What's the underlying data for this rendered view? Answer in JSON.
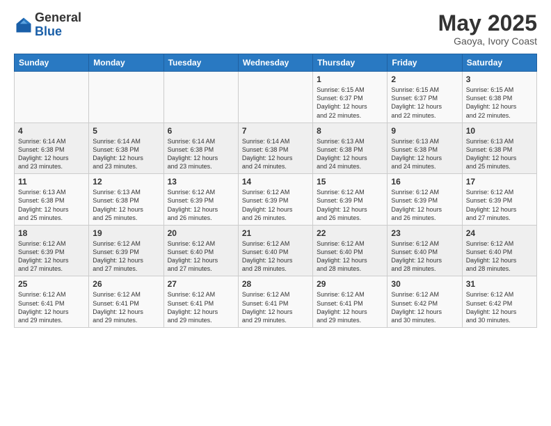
{
  "header": {
    "logo_general": "General",
    "logo_blue": "Blue",
    "month_year": "May 2025",
    "location": "Gaoya, Ivory Coast"
  },
  "weekdays": [
    "Sunday",
    "Monday",
    "Tuesday",
    "Wednesday",
    "Thursday",
    "Friday",
    "Saturday"
  ],
  "weeks": [
    [
      {
        "day": "",
        "info": ""
      },
      {
        "day": "",
        "info": ""
      },
      {
        "day": "",
        "info": ""
      },
      {
        "day": "",
        "info": ""
      },
      {
        "day": "1",
        "info": "Sunrise: 6:15 AM\nSunset: 6:37 PM\nDaylight: 12 hours\nand 22 minutes."
      },
      {
        "day": "2",
        "info": "Sunrise: 6:15 AM\nSunset: 6:37 PM\nDaylight: 12 hours\nand 22 minutes."
      },
      {
        "day": "3",
        "info": "Sunrise: 6:15 AM\nSunset: 6:38 PM\nDaylight: 12 hours\nand 22 minutes."
      }
    ],
    [
      {
        "day": "4",
        "info": "Sunrise: 6:14 AM\nSunset: 6:38 PM\nDaylight: 12 hours\nand 23 minutes."
      },
      {
        "day": "5",
        "info": "Sunrise: 6:14 AM\nSunset: 6:38 PM\nDaylight: 12 hours\nand 23 minutes."
      },
      {
        "day": "6",
        "info": "Sunrise: 6:14 AM\nSunset: 6:38 PM\nDaylight: 12 hours\nand 23 minutes."
      },
      {
        "day": "7",
        "info": "Sunrise: 6:14 AM\nSunset: 6:38 PM\nDaylight: 12 hours\nand 24 minutes."
      },
      {
        "day": "8",
        "info": "Sunrise: 6:13 AM\nSunset: 6:38 PM\nDaylight: 12 hours\nand 24 minutes."
      },
      {
        "day": "9",
        "info": "Sunrise: 6:13 AM\nSunset: 6:38 PM\nDaylight: 12 hours\nand 24 minutes."
      },
      {
        "day": "10",
        "info": "Sunrise: 6:13 AM\nSunset: 6:38 PM\nDaylight: 12 hours\nand 25 minutes."
      }
    ],
    [
      {
        "day": "11",
        "info": "Sunrise: 6:13 AM\nSunset: 6:38 PM\nDaylight: 12 hours\nand 25 minutes."
      },
      {
        "day": "12",
        "info": "Sunrise: 6:13 AM\nSunset: 6:38 PM\nDaylight: 12 hours\nand 25 minutes."
      },
      {
        "day": "13",
        "info": "Sunrise: 6:12 AM\nSunset: 6:39 PM\nDaylight: 12 hours\nand 26 minutes."
      },
      {
        "day": "14",
        "info": "Sunrise: 6:12 AM\nSunset: 6:39 PM\nDaylight: 12 hours\nand 26 minutes."
      },
      {
        "day": "15",
        "info": "Sunrise: 6:12 AM\nSunset: 6:39 PM\nDaylight: 12 hours\nand 26 minutes."
      },
      {
        "day": "16",
        "info": "Sunrise: 6:12 AM\nSunset: 6:39 PM\nDaylight: 12 hours\nand 26 minutes."
      },
      {
        "day": "17",
        "info": "Sunrise: 6:12 AM\nSunset: 6:39 PM\nDaylight: 12 hours\nand 27 minutes."
      }
    ],
    [
      {
        "day": "18",
        "info": "Sunrise: 6:12 AM\nSunset: 6:39 PM\nDaylight: 12 hours\nand 27 minutes."
      },
      {
        "day": "19",
        "info": "Sunrise: 6:12 AM\nSunset: 6:39 PM\nDaylight: 12 hours\nand 27 minutes."
      },
      {
        "day": "20",
        "info": "Sunrise: 6:12 AM\nSunset: 6:40 PM\nDaylight: 12 hours\nand 27 minutes."
      },
      {
        "day": "21",
        "info": "Sunrise: 6:12 AM\nSunset: 6:40 PM\nDaylight: 12 hours\nand 28 minutes."
      },
      {
        "day": "22",
        "info": "Sunrise: 6:12 AM\nSunset: 6:40 PM\nDaylight: 12 hours\nand 28 minutes."
      },
      {
        "day": "23",
        "info": "Sunrise: 6:12 AM\nSunset: 6:40 PM\nDaylight: 12 hours\nand 28 minutes."
      },
      {
        "day": "24",
        "info": "Sunrise: 6:12 AM\nSunset: 6:40 PM\nDaylight: 12 hours\nand 28 minutes."
      }
    ],
    [
      {
        "day": "25",
        "info": "Sunrise: 6:12 AM\nSunset: 6:41 PM\nDaylight: 12 hours\nand 29 minutes."
      },
      {
        "day": "26",
        "info": "Sunrise: 6:12 AM\nSunset: 6:41 PM\nDaylight: 12 hours\nand 29 minutes."
      },
      {
        "day": "27",
        "info": "Sunrise: 6:12 AM\nSunset: 6:41 PM\nDaylight: 12 hours\nand 29 minutes."
      },
      {
        "day": "28",
        "info": "Sunrise: 6:12 AM\nSunset: 6:41 PM\nDaylight: 12 hours\nand 29 minutes."
      },
      {
        "day": "29",
        "info": "Sunrise: 6:12 AM\nSunset: 6:41 PM\nDaylight: 12 hours\nand 29 minutes."
      },
      {
        "day": "30",
        "info": "Sunrise: 6:12 AM\nSunset: 6:42 PM\nDaylight: 12 hours\nand 30 minutes."
      },
      {
        "day": "31",
        "info": "Sunrise: 6:12 AM\nSunset: 6:42 PM\nDaylight: 12 hours\nand 30 minutes."
      }
    ]
  ]
}
